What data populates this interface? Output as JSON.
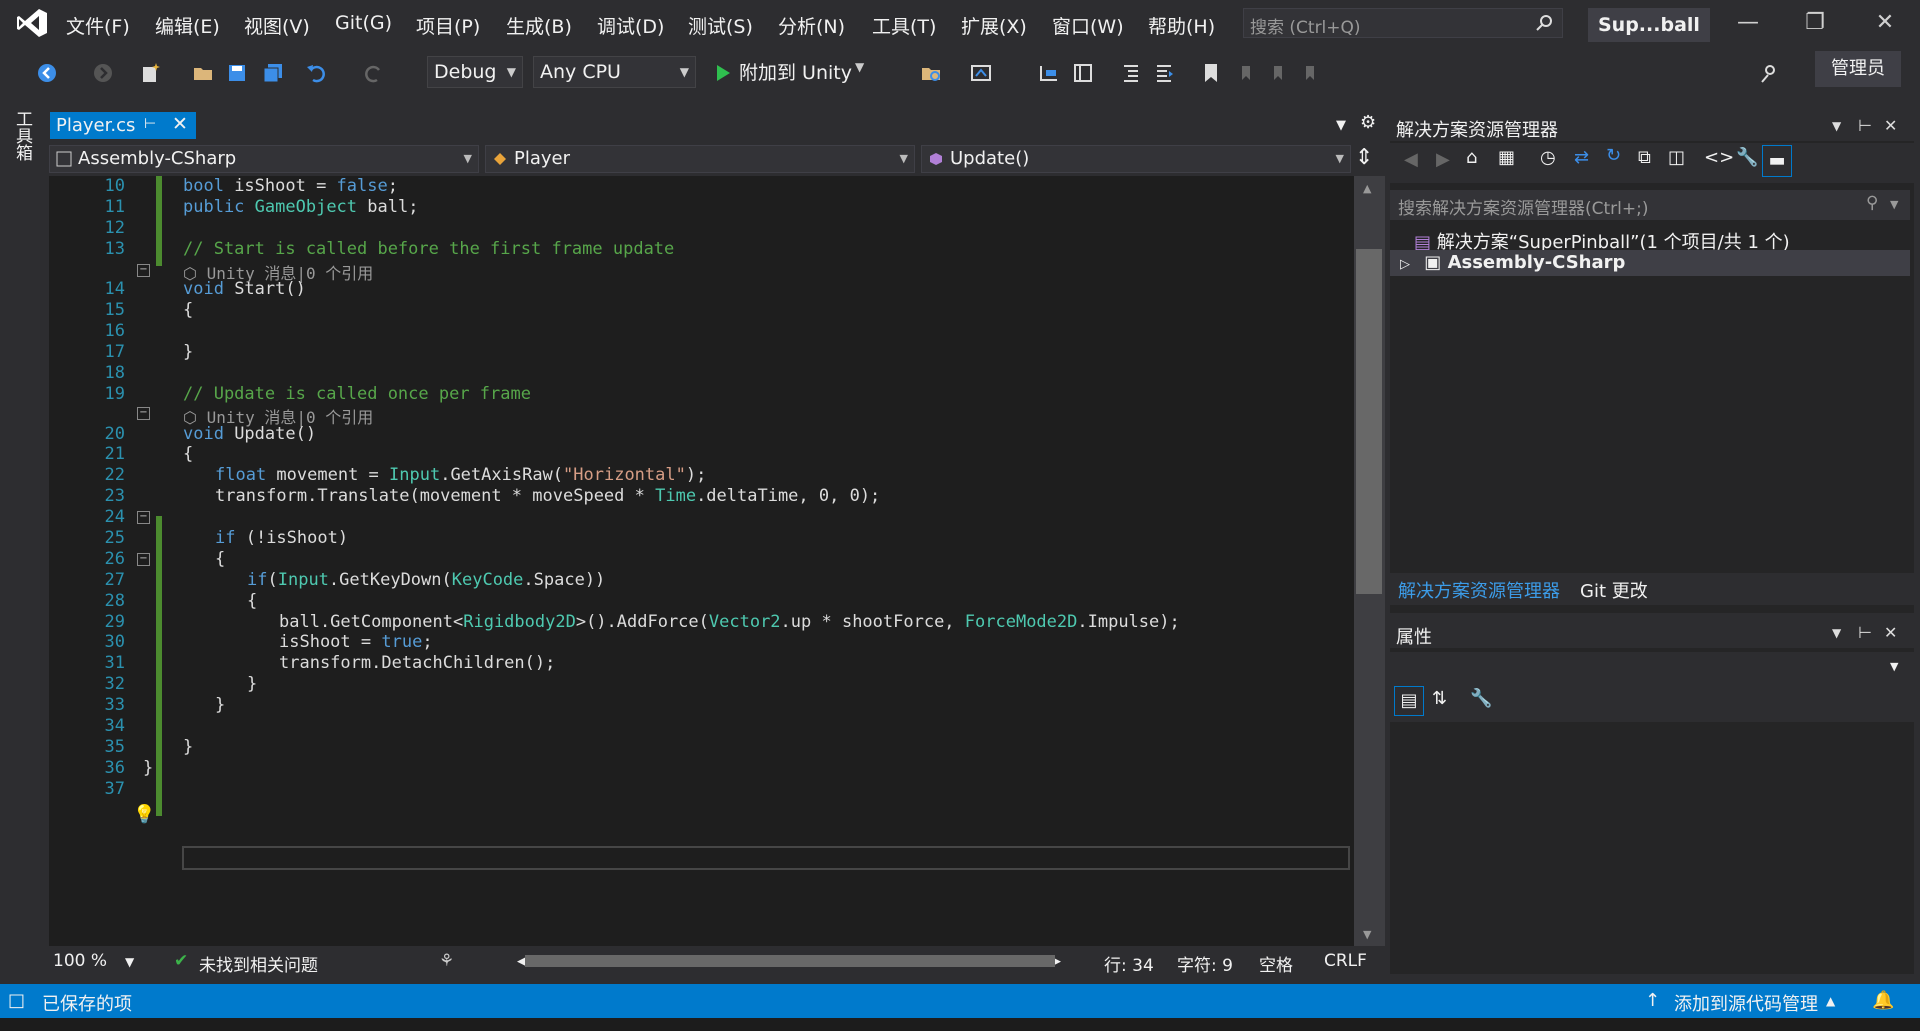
{
  "menu": [
    "文件(F)",
    "编辑(E)",
    "视图(V)",
    "Git(G)",
    "项目(P)",
    "生成(B)",
    "调试(D)",
    "测试(S)",
    "分析(N)",
    "工具(T)",
    "扩展(X)",
    "窗口(W)",
    "帮助(H)"
  ],
  "search": {
    "placeholder": "搜索 (Ctrl+Q)"
  },
  "solution_short_name": "Sup...ball",
  "toolbar": {
    "config": "Debug",
    "platform": "Any CPU",
    "attach_label": "附加到 Unity",
    "admin_label": "管理员"
  },
  "toolbox_label": "工具箱",
  "editor": {
    "tab_title": "Player.cs",
    "nav": {
      "project": "Assembly-CSharp",
      "class": "Player",
      "member": "Update()"
    },
    "lines": [
      {
        "n": "10",
        "text": "bool isShoot = false;"
      },
      {
        "n": "11",
        "text": "public GameObject ball;"
      },
      {
        "n": "12",
        "text": ""
      },
      {
        "n": "13",
        "text": "// Start is called before the first frame update"
      },
      {
        "n": "",
        "text": "Unity 消息|0 个引用"
      },
      {
        "n": "14",
        "text": "void Start()"
      },
      {
        "n": "15",
        "text": "{"
      },
      {
        "n": "16",
        "text": ""
      },
      {
        "n": "17",
        "text": "}"
      },
      {
        "n": "18",
        "text": ""
      },
      {
        "n": "19",
        "text": "// Update is called once per frame"
      },
      {
        "n": "",
        "text": "Unity 消息|0 个引用"
      },
      {
        "n": "20",
        "text": "void Update()"
      },
      {
        "n": "21",
        "text": "{"
      },
      {
        "n": "22",
        "text": "float movement = Input.GetAxisRaw(\"Horizontal\");"
      },
      {
        "n": "23",
        "text": "transform.Translate(movement * moveSpeed * Time.deltaTime, 0, 0);"
      },
      {
        "n": "24",
        "text": ""
      },
      {
        "n": "25",
        "text": "if (!isShoot)"
      },
      {
        "n": "26",
        "text": "{"
      },
      {
        "n": "27",
        "text": "if(Input.GetKeyDown(KeyCode.Space))"
      },
      {
        "n": "28",
        "text": "{"
      },
      {
        "n": "29",
        "text": "ball.GetComponent<Rigidbody2D>().AddForce(Vector2.up * shootForce, ForceMode2D.Impulse);"
      },
      {
        "n": "30",
        "text": "isShoot = true;"
      },
      {
        "n": "31",
        "text": "transform.DetachChildren();"
      },
      {
        "n": "32",
        "text": "}"
      },
      {
        "n": "33",
        "text": "}"
      },
      {
        "n": "34",
        "text": ""
      },
      {
        "n": "35",
        "text": "}"
      },
      {
        "n": "36",
        "text": "}"
      },
      {
        "n": "37",
        "text": ""
      }
    ],
    "status": {
      "zoom": "100 %",
      "issues": "未找到相关问题",
      "row": "行: 34",
      "col": "字符: 9",
      "spacing": "空格",
      "eol": "CRLF"
    }
  },
  "solution_explorer": {
    "title": "解决方案资源管理器",
    "search_placeholder": "搜索解决方案资源管理器(Ctrl+;)",
    "solution_node": "解决方案“SuperPinball”(1 个项目/共 1 个)",
    "project_node": "Assembly-CSharp",
    "tabs": [
      "解决方案资源管理器",
      "Git 更改"
    ]
  },
  "properties": {
    "title": "属性"
  },
  "statusbar": {
    "saved": "已保存的项",
    "source_control": "添加到源代码管理"
  }
}
